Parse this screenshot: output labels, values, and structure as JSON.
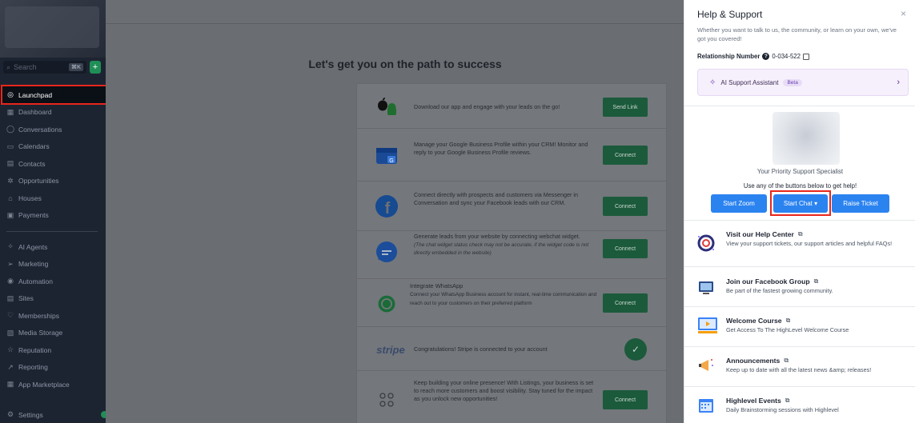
{
  "sidebar": {
    "search_placeholder": "Search",
    "search_shortcut": "⌘K",
    "add_label": "+",
    "items": [
      {
        "label": "Launchpad",
        "icon": "rocket-icon",
        "glyph": "◎"
      },
      {
        "label": "Dashboard",
        "icon": "dashboard-icon",
        "glyph": "▦"
      },
      {
        "label": "Conversations",
        "icon": "chat-icon",
        "glyph": "◯"
      },
      {
        "label": "Calendars",
        "icon": "calendar-icon",
        "glyph": "▭"
      },
      {
        "label": "Contacts",
        "icon": "contacts-icon",
        "glyph": "▤"
      },
      {
        "label": "Opportunities",
        "icon": "opportunities-icon",
        "glyph": "✲"
      },
      {
        "label": "Houses",
        "icon": "house-icon",
        "glyph": "⌂"
      },
      {
        "label": "Payments",
        "icon": "payments-icon",
        "glyph": "▣"
      }
    ],
    "items2": [
      {
        "label": "AI Agents",
        "icon": "ai-agents-icon",
        "glyph": "✧"
      },
      {
        "label": "Marketing",
        "icon": "marketing-icon",
        "glyph": "➢"
      },
      {
        "label": "Automation",
        "icon": "automation-icon",
        "glyph": "◉"
      },
      {
        "label": "Sites",
        "icon": "sites-icon",
        "glyph": "▤"
      },
      {
        "label": "Memberships",
        "icon": "memberships-icon",
        "glyph": "♡"
      },
      {
        "label": "Media Storage",
        "icon": "media-icon",
        "glyph": "▨"
      },
      {
        "label": "Reputation",
        "icon": "star-icon",
        "glyph": "☆"
      },
      {
        "label": "Reporting",
        "icon": "reporting-icon",
        "glyph": "↗"
      },
      {
        "label": "App Marketplace",
        "icon": "marketplace-icon",
        "glyph": "▦"
      }
    ],
    "settings": {
      "label": "Settings",
      "icon": "gear-icon",
      "glyph": "⚙"
    }
  },
  "main": {
    "title": "Let's get you on the path to success",
    "rows": [
      {
        "text": "Download our app and engage with your leads on the go!",
        "button": "Send Link"
      },
      {
        "text": "Manage your Google Business Profile within your CRM! Monitor and reply to your Google Business Profile reviews.",
        "button": "Connect"
      },
      {
        "text": "Connect directly with prospects and customers via Messenger in Conversation and sync your Facebook leads with our CRM.",
        "button": "Connect"
      },
      {
        "text": "Generate leads from your website by connecting webchat widget.",
        "note": "(The chat widget status check may not be accurate, if the widget code is not directly embedded in the website)",
        "button": "Connect"
      },
      {
        "title": "Integrate WhatsApp",
        "text": "Connect your WhatsApp Business account for instant, real-time communication and reach out to your customers on their preferred platform",
        "button": "Connect"
      },
      {
        "logo": "stripe",
        "text": "Congratulations! Stripe is connected to your account"
      },
      {
        "text": "Keep building your online presence! With Listings, your business is set to reach more customers and boost visibility. Stay tuned for the impact as you unlock new opportunities!",
        "button": "Connect"
      }
    ]
  },
  "panel": {
    "title": "Help & Support",
    "close": "×",
    "subtitle": "Whether you want to talk to us, the community, or learn on your own, we've got you covered!",
    "relationship_label": "Relationship Number",
    "relationship_value": "0-034-522",
    "ai_label": "AI Support Assistant",
    "ai_badge": "Beta",
    "specialist": "Your Priority Support Specialist",
    "use_any": "Use any of the buttons below to get help!",
    "buttons": {
      "zoom": "Start Zoom",
      "chat": "Start Chat ▾",
      "ticket": "Raise Ticket"
    },
    "links": [
      {
        "title": "Visit our Help Center",
        "desc": "View your support tickets, our support articles and helpful FAQs!",
        "icon": "help-center-icon"
      },
      {
        "title": "Join our Facebook Group",
        "desc": "Be part of the fastest growing community.",
        "icon": "facebook-group-icon"
      },
      {
        "title": "Welcome Course",
        "desc": "Get Access To The HighLevel Welcome Course",
        "icon": "course-icon"
      },
      {
        "title": "Announcements",
        "desc": "Keep up to date with all the latest news &amp; releases!",
        "icon": "megaphone-icon"
      },
      {
        "title": "Highlevel Events",
        "desc": "Daily Brainstorming sessions with Highlevel",
        "icon": "events-icon"
      }
    ],
    "ext_glyph": "⧉"
  },
  "colors": {
    "accent_blue": "#2b83f0",
    "highlight_red": "#e8261b",
    "sidebar_bg": "#1d2431"
  }
}
